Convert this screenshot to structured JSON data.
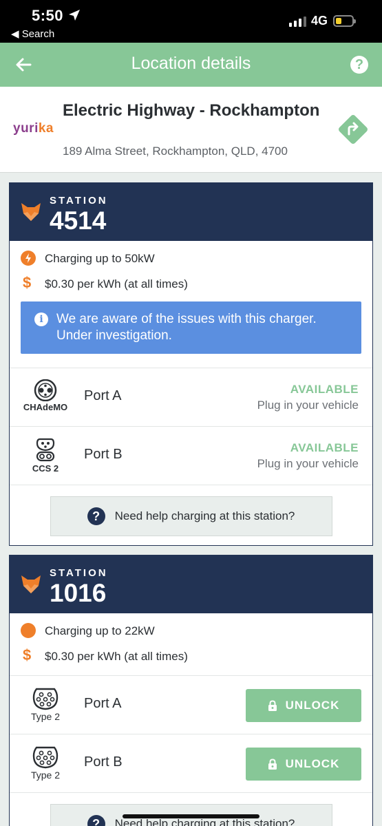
{
  "status_bar": {
    "time": "5:50",
    "back_label": "◀ Search",
    "network": "4G"
  },
  "nav": {
    "title": "Location details"
  },
  "location": {
    "logo_main": "yuri",
    "logo_accent": "ka",
    "name": "Electric Highway - Rockhampton",
    "address": "189 Alma Street, Rockhampton, QLD, 4700"
  },
  "stations": [
    {
      "label": "STATION",
      "number": "4514",
      "power": "Charging up to 50kW",
      "price": "$0.30 per kWh (at all times)",
      "alert": "We are aware of the issues with this charger. Under investigation.",
      "ports": [
        {
          "plug": "CHAdeMO",
          "name": "Port A",
          "status": "AVAILABLE",
          "hint": "Plug in your vehicle"
        },
        {
          "plug": "CCS 2",
          "name": "Port B",
          "status": "AVAILABLE",
          "hint": "Plug in your vehicle"
        }
      ],
      "help": "Need help charging at this station?"
    },
    {
      "label": "STATION",
      "number": "1016",
      "power": "Charging up to 22kW",
      "price": "$0.30 per kWh (at all times)",
      "ports": [
        {
          "plug": "Type 2",
          "name": "Port A",
          "action": "UNLOCK"
        },
        {
          "plug": "Type 2",
          "name": "Port B",
          "action": "UNLOCK"
        }
      ],
      "help": "Need help charging at this station?"
    }
  ],
  "icons": {
    "back": "arrow-left-icon",
    "help": "question-circle-icon",
    "directions": "directions-diamond-icon",
    "station": "fox-icon",
    "power": "lightning-icon",
    "price": "dollar-icon",
    "info": "info-icon",
    "lock": "lock-icon"
  },
  "colors": {
    "brand_green": "#87c797",
    "navy": "#223354",
    "orange": "#ef7f2a",
    "alert_blue": "#5b8fe0"
  }
}
